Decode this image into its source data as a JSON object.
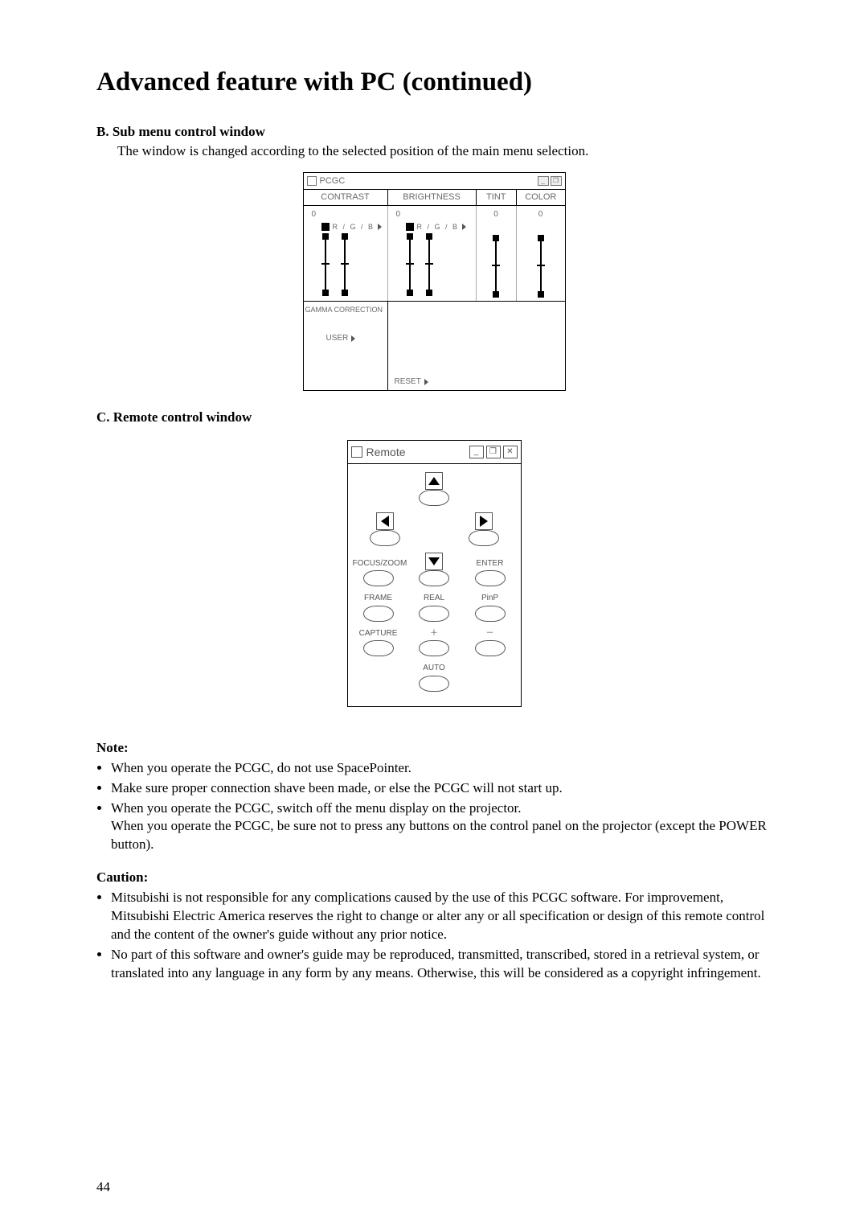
{
  "page": {
    "title": "Advanced feature with PC (continued)",
    "number": "44"
  },
  "sectionB": {
    "heading": "B. Sub menu control window",
    "desc": "The window is changed according to the selected position of the main menu selection."
  },
  "pcgc": {
    "title": "PCGC",
    "cols": {
      "contrast": "CONTRAST",
      "brightness": "BRIGHTNESS",
      "tint": "TINT",
      "color": "COLOR"
    },
    "vals": {
      "contrast": "0",
      "brightness": "0",
      "tint": "0",
      "color": "0"
    },
    "rgb": "R / G / B",
    "gamma": "GAMMA CORRECTION",
    "user": "USER",
    "reset": "RESET"
  },
  "sectionC": {
    "heading": "C. Remote control window"
  },
  "remote": {
    "title": "Remote",
    "labels": {
      "focuszoom": "FOCUS/ZOOM",
      "enter": "ENTER",
      "frame": "FRAME",
      "real": "REAL",
      "pinp": "PinP",
      "capture": "CAPTURE",
      "plus": "＋",
      "minus": "－",
      "auto": "AUTO"
    }
  },
  "note": {
    "heading": "Note:",
    "items": [
      "When you operate the PCGC, do not use SpacePointer.",
      "Make sure proper connection shave been made, or else the PCGC will not start up.",
      "When you operate the PCGC, switch off the menu display on the projector."
    ],
    "itemExtra": "When you operate the PCGC, be sure not to press any buttons on the control panel on the projector (except the POWER button)."
  },
  "caution": {
    "heading": "Caution:",
    "items": [
      "Mitsubishi is not responsible for any complications caused by the use of this PCGC software. For improvement, Mitsubishi Electric America reserves the right to change or alter any or all specification or design of this remote control and the content of the owner's guide without any prior notice.",
      "No part of this software and owner's guide may be reproduced, transmitted, transcribed, stored in a retrieval system, or translated into any language in any form by any means. Otherwise, this will be considered as a copyright infringement."
    ]
  }
}
